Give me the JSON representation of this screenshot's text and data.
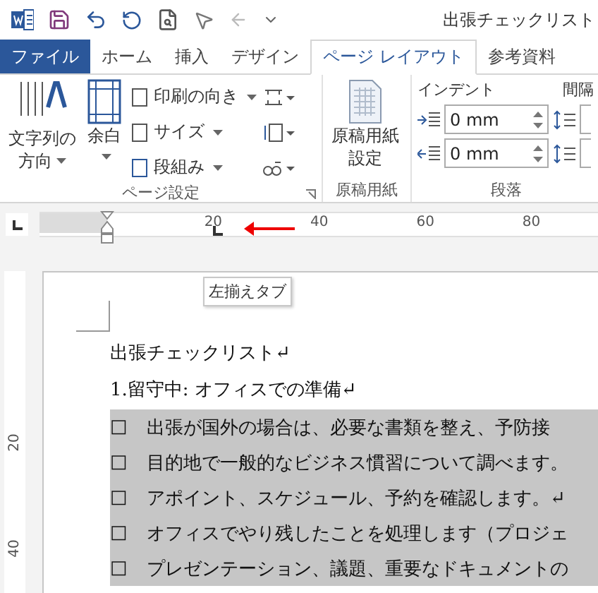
{
  "window": {
    "title": "出張チェックリスト"
  },
  "tabs": [
    {
      "label": "ファイル",
      "kind": "file",
      "selected": false
    },
    {
      "label": "ホーム",
      "kind": "tab",
      "selected": false
    },
    {
      "label": "挿入",
      "kind": "tab",
      "selected": false
    },
    {
      "label": "デザイン",
      "kind": "tab",
      "selected": false
    },
    {
      "label": "ページ レイアウト",
      "kind": "tab",
      "selected": true
    },
    {
      "label": "参考資料",
      "kind": "tab",
      "selected": false
    }
  ],
  "ribbon": {
    "page_setup": {
      "label": "ページ設定",
      "text_direction": [
        "文字列の",
        "方向"
      ],
      "margins": "余白",
      "small_buttons": [
        "印刷の向き",
        "サイズ",
        "段組み"
      ]
    },
    "manuscript": {
      "label": "原稿用紙",
      "button": [
        "原稿用紙",
        "設定"
      ]
    },
    "paragraph": {
      "label": "段落",
      "indent_label": "インデント",
      "spacing_label": "間隔",
      "indent_fields": [
        {
          "value": "0 mm"
        },
        {
          "value": "0 mm"
        }
      ]
    }
  },
  "ruler": {
    "ticks": [
      "20",
      "40",
      "60",
      "80"
    ]
  },
  "tooltip": "左揃えタブ",
  "vertical_ruler": {
    "ticks": [
      "20",
      "40"
    ]
  },
  "document": {
    "lines": [
      {
        "text": "出張チェックリスト↵"
      },
      {
        "text": "1.留守中: オフィスでの準備↵"
      }
    ],
    "checklist": [
      {
        "box": "□",
        "text": "出張が国外の場合は、必要な書類を整え、予防接",
        "highlighted": true
      },
      {
        "box": "□",
        "text": "目的地で一般的なビジネス慣習について調べます。",
        "highlighted": true
      },
      {
        "box": "□",
        "text": "アポイント、スケジュール、予約を確認します。↵",
        "highlighted": true
      },
      {
        "box": "□",
        "text": "オフィスでやり残したことを処理します（プロジェ",
        "highlighted": true
      },
      {
        "box": "□",
        "text": "プレゼンテーション、議題、重要なドキュメントの",
        "highlighted": true
      }
    ]
  }
}
